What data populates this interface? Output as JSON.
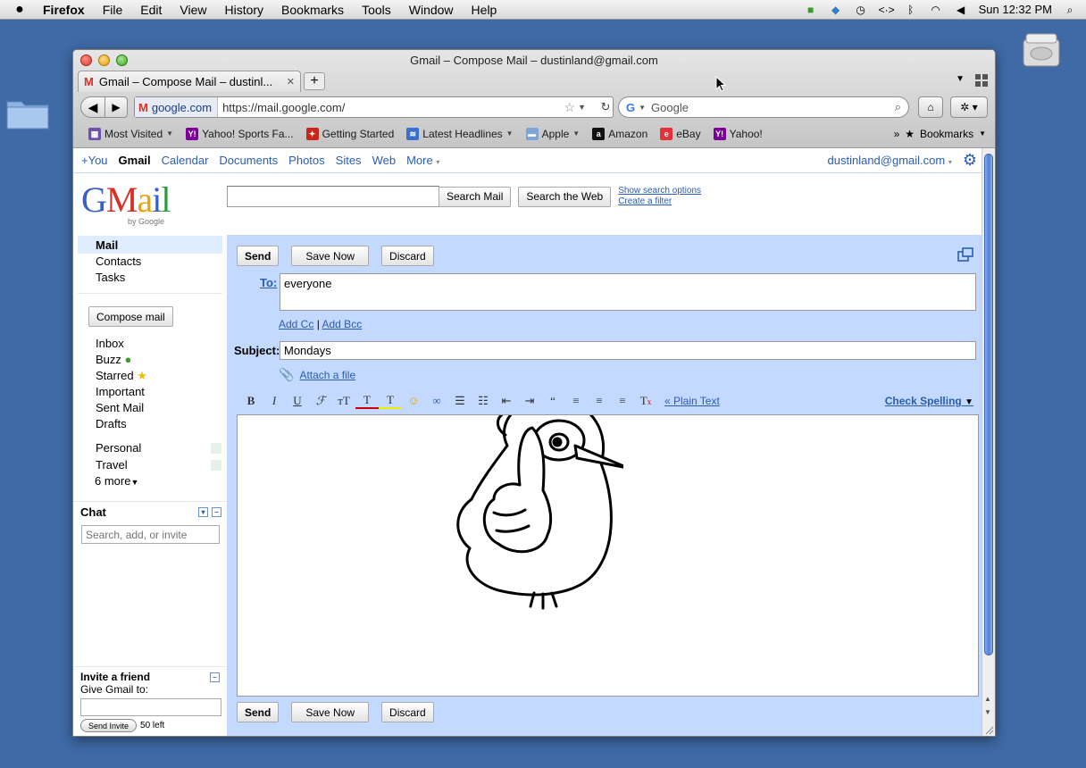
{
  "menubar": {
    "app": "Firefox",
    "items": [
      "File",
      "Edit",
      "View",
      "History",
      "Bookmarks",
      "Tools",
      "Window",
      "Help"
    ],
    "clock": "Sun 12:32 PM"
  },
  "window": {
    "title": "Gmail – Compose Mail – dustinland@gmail.com",
    "tab_title": "Gmail – Compose Mail – dustinl..."
  },
  "navbar": {
    "site_identity": "google.com",
    "url": "https://mail.google.com/",
    "search_placeholder": "Google"
  },
  "bookmarks": [
    {
      "label": "Most Visited",
      "dropdown": true,
      "icon_color": "#6d52a8",
      "icon_text": "▦"
    },
    {
      "label": "Yahoo! Sports Fa...",
      "dropdown": false,
      "icon_color": "#7b0099",
      "icon_text": "Y!"
    },
    {
      "label": "Getting Started",
      "dropdown": false,
      "icon_color": "#c8261a",
      "icon_text": "✦"
    },
    {
      "label": "Latest Headlines",
      "dropdown": true,
      "icon_color": "#3a6fcf",
      "icon_text": "≋"
    },
    {
      "label": "Apple",
      "dropdown": true,
      "icon_color": "#7fa4d6",
      "icon_text": "▬"
    },
    {
      "label": "Amazon",
      "dropdown": false,
      "icon_color": "#111111",
      "icon_text": "a"
    },
    {
      "label": "eBay",
      "dropdown": false,
      "icon_color": "#e53238",
      "icon_text": "e"
    },
    {
      "label": "Yahoo!",
      "dropdown": false,
      "icon_color": "#7b0099",
      "icon_text": "Y!"
    }
  ],
  "bookmarks_menu": "Bookmarks",
  "gbar": {
    "links": [
      "+You",
      "Gmail",
      "Calendar",
      "Documents",
      "Photos",
      "Sites",
      "Web",
      "More"
    ],
    "active": "Gmail",
    "account": "dustinland@gmail.com"
  },
  "search": {
    "search_mail": "Search Mail",
    "search_web": "Search the Web",
    "show_options": "Show search options",
    "create_filter": "Create a filter"
  },
  "logo": {
    "by": "by Google"
  },
  "leftnav": {
    "primary": [
      "Mail",
      "Contacts",
      "Tasks"
    ],
    "compose": "Compose mail",
    "folders": [
      "Inbox",
      "Buzz",
      "Starred",
      "Important",
      "Sent Mail",
      "Drafts"
    ],
    "labels": [
      "Personal",
      "Travel"
    ],
    "more_labels": "6 more",
    "chat_title": "Chat",
    "chat_placeholder": "Search, add, or invite",
    "invite_title": "Invite a friend",
    "invite_prompt": "Give Gmail to:",
    "send_invite": "Send Invite",
    "invites_left": "50 left"
  },
  "compose": {
    "send": "Send",
    "save_now": "Save Now",
    "discard": "Discard",
    "to_label": "To:",
    "to_value": "everyone",
    "add_cc": "Add Cc",
    "cc_sep": "|",
    "add_bcc": "Add Bcc",
    "subject_label": "Subject:",
    "subject_value": "Mondays",
    "attach": "Attach a file",
    "plain_text": "« Plain Text",
    "check_spelling": "Check Spelling"
  },
  "colors": {
    "compose_bg": "#c3d9ff",
    "link": "#2a5db0",
    "desktop": "#3f6aa6"
  }
}
